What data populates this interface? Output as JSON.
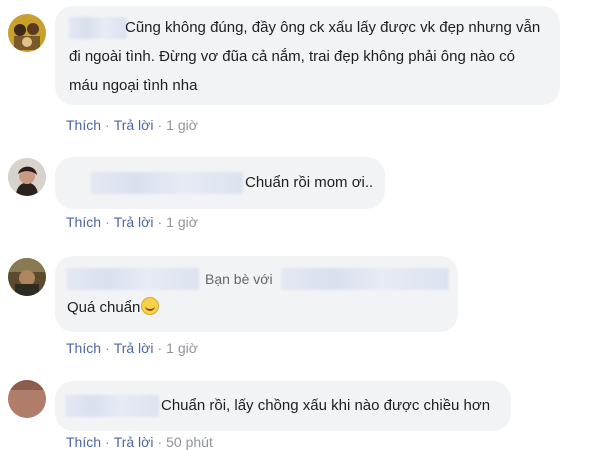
{
  "comments": [
    {
      "text_lines": [
        "Cũng không đúng, đầy ông ck xấu lấy được vk đẹp nhưng vẫn",
        "đi ngoài tình. Đừng vơ đũa cả nắm, trai đẹp không phải ông nào có",
        "máu ngoại tình nha"
      ],
      "actions": {
        "like": "Thích",
        "reply": "Trả lời",
        "time": "1 giờ"
      }
    },
    {
      "text": "Chuẩn rồi mom ơi..",
      "actions": {
        "like": "Thích",
        "reply": "Trả lời",
        "time": "1 giờ"
      }
    },
    {
      "friend_prefix": "Bạn bè với",
      "text": "Quá chuẩn",
      "emoji": "hugging-face-emoji",
      "actions": {
        "like": "Thích",
        "reply": "Trả lời",
        "time": "1 giờ"
      }
    },
    {
      "text": "Chuẩn rồi, lấy chồng xấu khi nào được chiều hơn",
      "actions": {
        "like": "Thích",
        "reply": "Trả lời",
        "time": "50 phút"
      }
    }
  ],
  "separator": "·"
}
